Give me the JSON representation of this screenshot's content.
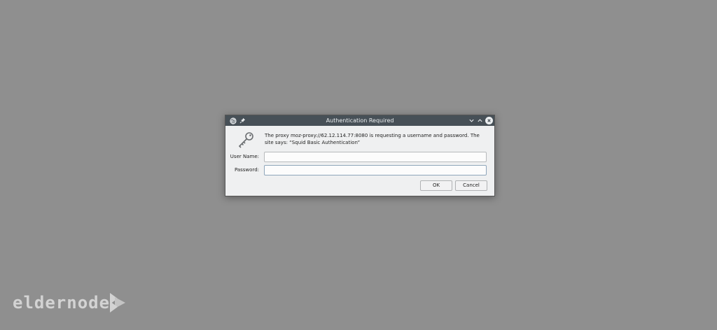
{
  "dialog": {
    "title": "Authentication Required",
    "message": "The proxy moz-proxy://62.12.114.77:8080 is requesting a username and password. The site says: “Squid Basic Authentication”",
    "fields": {
      "username_label": "User Name:",
      "username_value": "",
      "password_label": "Password:",
      "password_value": ""
    },
    "buttons": {
      "ok": "OK",
      "cancel": "Cancel"
    },
    "icons": {
      "app": "globe-icon",
      "pin": "pin-icon",
      "minimize": "chevron-down-icon",
      "maximize": "chevron-up-icon",
      "close": "close-icon",
      "auth": "key-icon"
    }
  },
  "watermark": {
    "text": "eldernode"
  },
  "colors": {
    "background": "#8f8f8f",
    "titlebar": "#475057",
    "dialog": "#eff0f1"
  }
}
